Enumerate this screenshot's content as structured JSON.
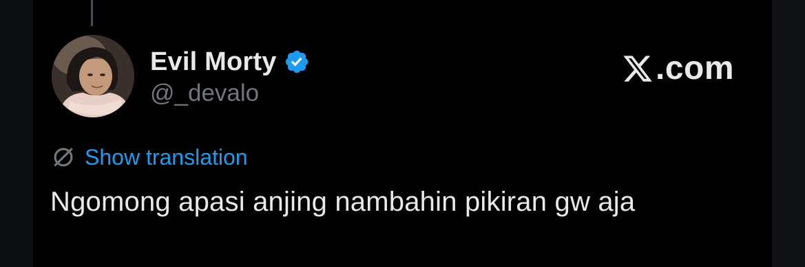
{
  "author": {
    "display_name": "Evil Morty",
    "handle": "@_devalo",
    "verified_color": "#1d9bf0"
  },
  "branding": {
    "site_text": ".com",
    "icon": "x-logo-icon"
  },
  "translation": {
    "label": "Show translation",
    "icon": "globe-icon",
    "link_color": "#1d9bf0"
  },
  "tweet": {
    "text": "Ngomong apasi anjing nambahin pikiran gw aja"
  }
}
